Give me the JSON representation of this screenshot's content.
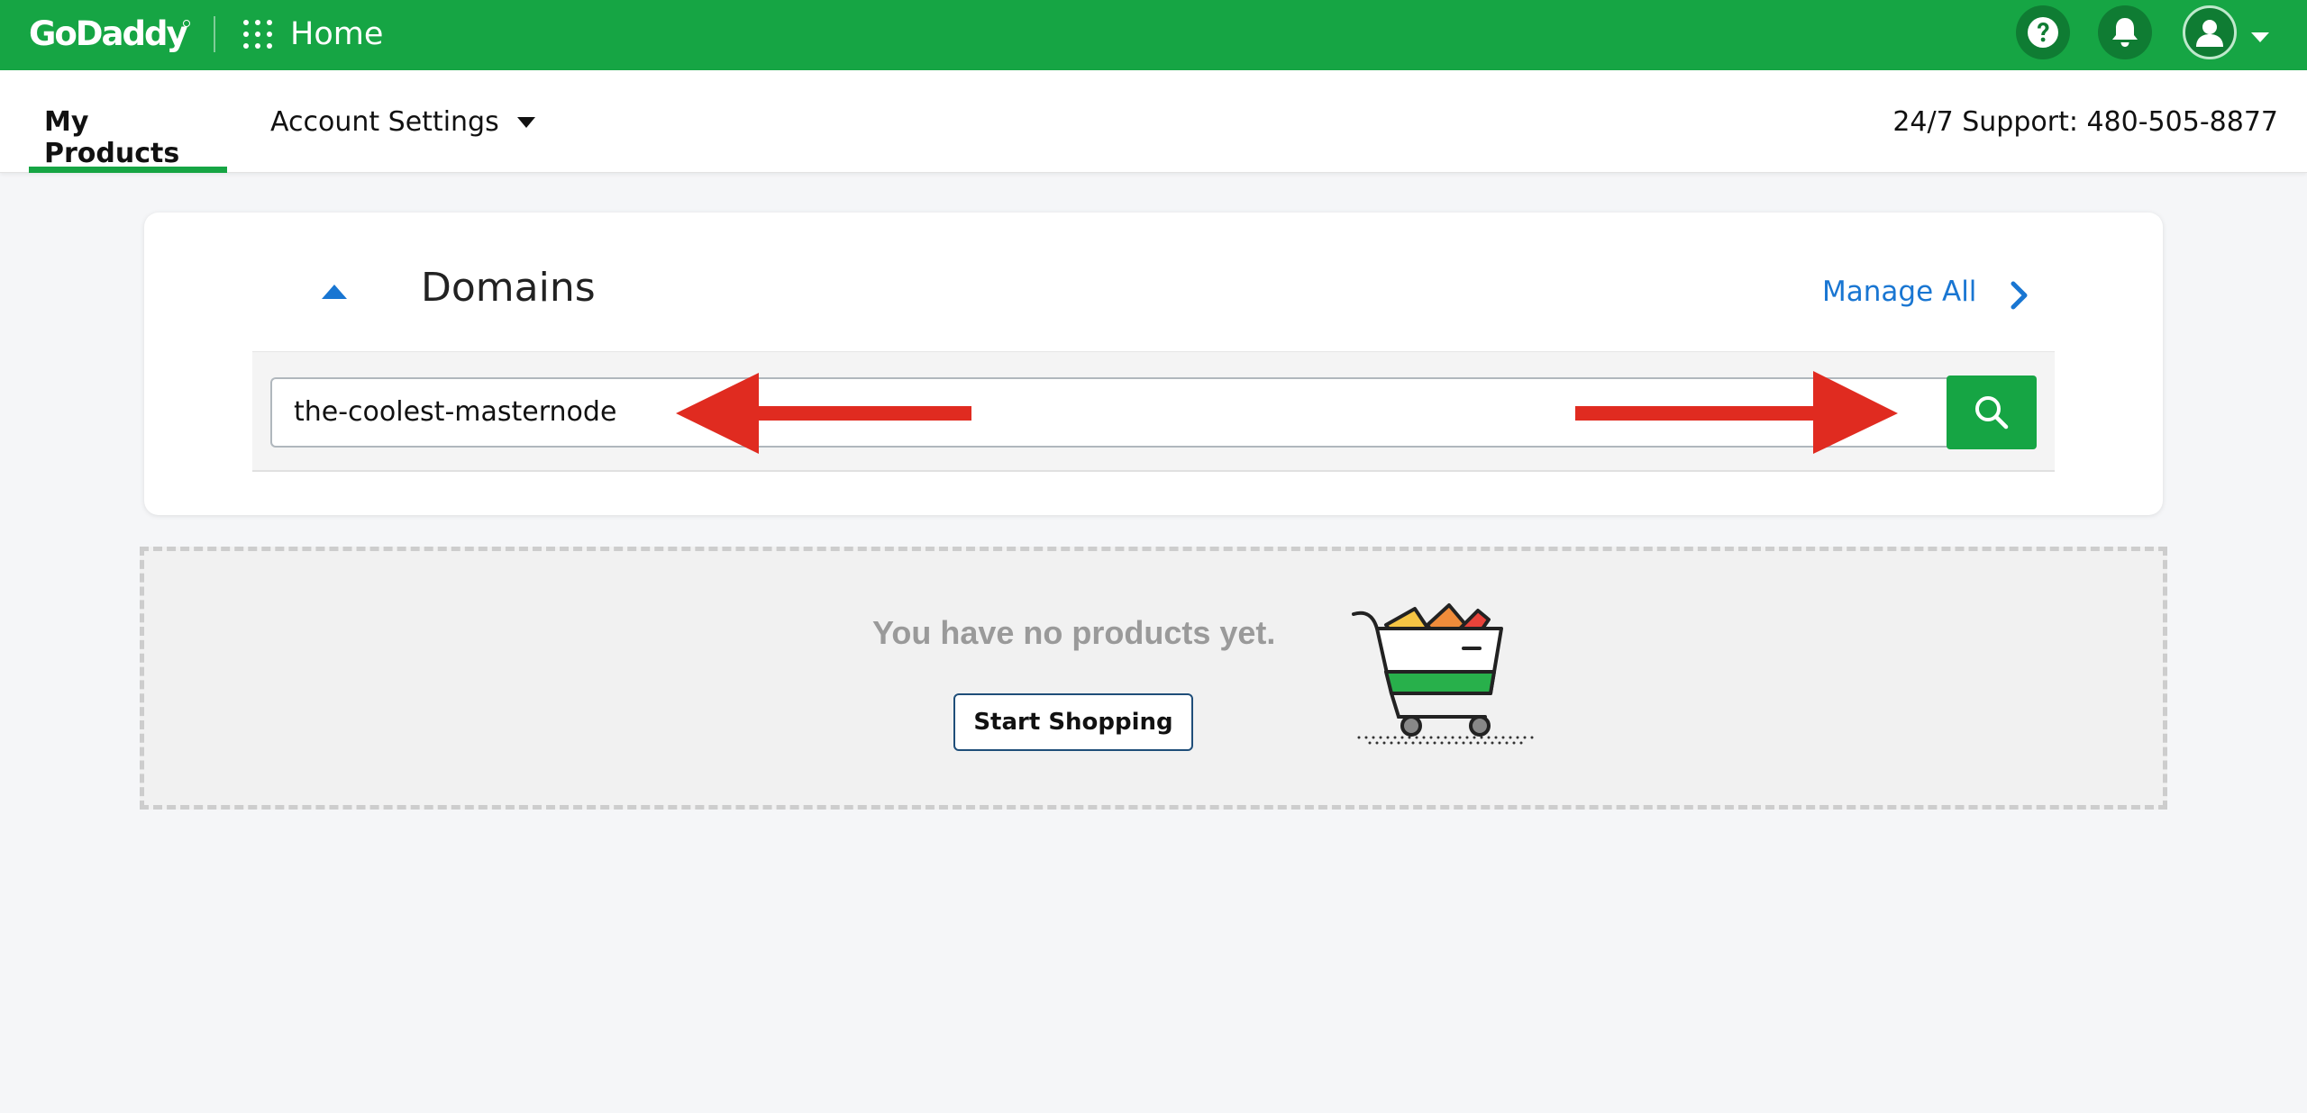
{
  "topbar": {
    "logo": "GoDaddy",
    "app_title": "Home",
    "colors": {
      "brand_green": "#16a544",
      "icon_circle": "#0f7c33"
    },
    "icons": [
      "apps-grid-icon",
      "help-icon",
      "bell-icon",
      "user-avatar-icon",
      "chevron-down-icon"
    ]
  },
  "nav": {
    "tabs": [
      {
        "label": "My Products",
        "active": true
      },
      {
        "label": "Account Settings",
        "active": false
      }
    ],
    "support_text": "24/7 Support: 480-505-8877"
  },
  "domains_card": {
    "title": "Domains",
    "manage_all_label": "Manage All",
    "search_value": "the-coolest-masternode",
    "link_color": "#1976d2"
  },
  "empty_state": {
    "message": "You have no products yet.",
    "button_label": "Start Shopping"
  },
  "annotations": {
    "arrow_color": "#e02b20"
  }
}
